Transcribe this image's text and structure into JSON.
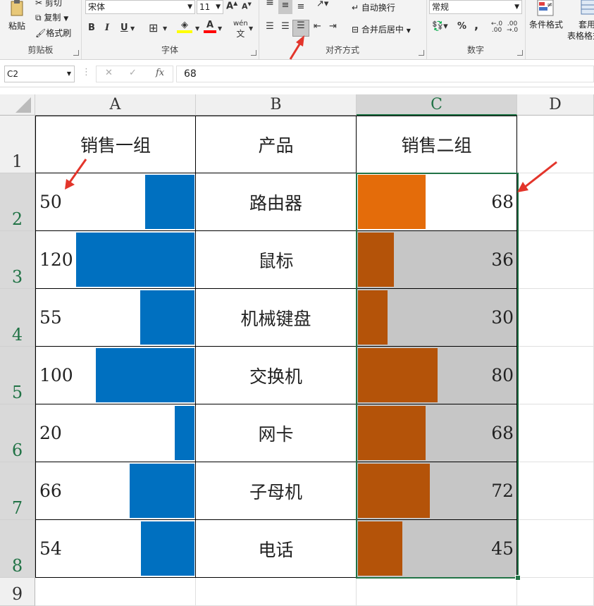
{
  "ribbon": {
    "clipboard": {
      "group_label": "剪贴板",
      "paste": "粘贴",
      "cut": "剪切",
      "copy": "复制",
      "format_painter": "格式刷"
    },
    "font": {
      "group_label": "字体",
      "font_name": "宋体",
      "font_size": "11",
      "bold": "B",
      "italic": "I",
      "underline": "U",
      "increase_size": "A",
      "decrease_size": "A",
      "font_color_glyph": "A",
      "phonetic": "wén"
    },
    "alignment": {
      "group_label": "对齐方式",
      "wrap_text": "自动换行",
      "merge_center": "合并后居中"
    },
    "number": {
      "group_label": "数字",
      "format": "常规",
      "percent": "%",
      "comma": ","
    },
    "styles": {
      "conditional_formatting": "条件格式",
      "format_as_table_line1": "套用",
      "format_as_table_line2": "表格格式"
    }
  },
  "formula_bar": {
    "name_box": "C2",
    "formula": "68",
    "fx": "fx"
  },
  "columns": [
    "A",
    "B",
    "C",
    "D"
  ],
  "rows": [
    "1",
    "2",
    "3",
    "4",
    "5",
    "6",
    "7",
    "8",
    "9"
  ],
  "table": {
    "headers": [
      "销售一组",
      "产品",
      "销售二组"
    ],
    "group1": [
      50,
      120,
      55,
      100,
      20,
      66,
      54
    ],
    "products": [
      "路由器",
      "鼠标",
      "机械键盘",
      "交换机",
      "网卡",
      "子母机",
      "电话"
    ],
    "group2": [
      68,
      36,
      30,
      80,
      68,
      72,
      45
    ],
    "group1_max": 120,
    "group2_max": 100
  },
  "colors": {
    "group1_bar": "#0070c0",
    "group2_bar": "#b45309",
    "group2_bar_selected": "#e46c0a",
    "group2_bg": "#c6c6c6",
    "selection": "#217346",
    "annotation_arrow": "#e3352b"
  }
}
